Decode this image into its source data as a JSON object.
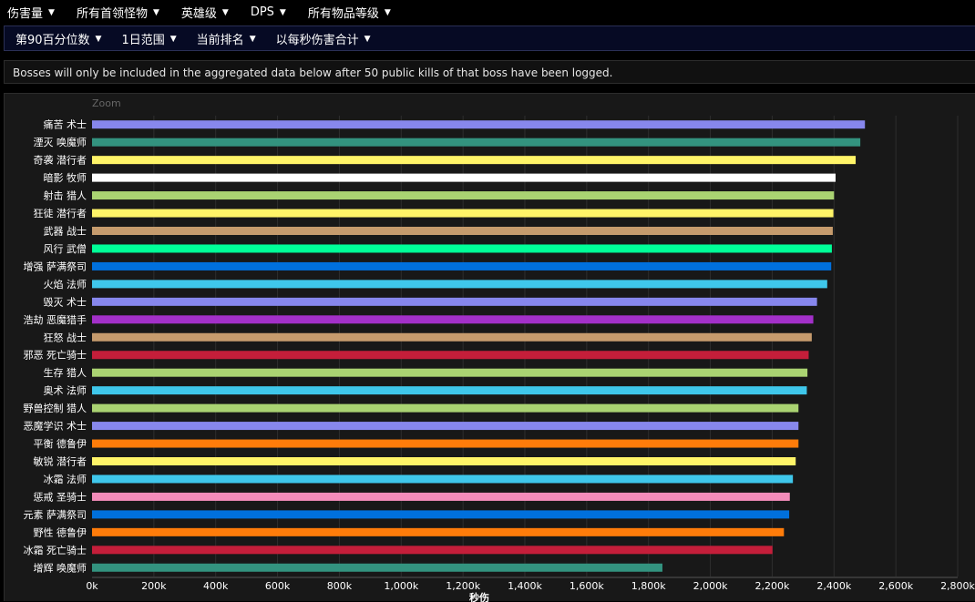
{
  "top_filters": [
    {
      "label": "伤害量",
      "icon": "caret-down-icon"
    },
    {
      "label": "所有首领怪物",
      "icon": "caret-down-icon"
    },
    {
      "label": "英雄级",
      "icon": "caret-down-icon"
    },
    {
      "label": "DPS",
      "icon": "caret-down-icon"
    },
    {
      "label": "所有物品等级",
      "icon": "caret-down-icon"
    }
  ],
  "sub_filters": [
    {
      "label": "第90百分位数",
      "icon": "caret-down-icon"
    },
    {
      "label": "1日范围",
      "icon": "caret-down-icon"
    },
    {
      "label": "当前排名",
      "icon": "caret-down-icon"
    },
    {
      "label": "以每秒伤害合计",
      "icon": "caret-down-icon"
    }
  ],
  "notice": "Bosses will only be included in the aggregated data below after 50 public kills of that boss have been logged.",
  "zoom_label": "Zoom",
  "chart_data": {
    "type": "bar",
    "orientation": "horizontal",
    "title": "",
    "xlabel": "秒伤",
    "ylabel": "",
    "xlim": [
      0,
      2800000
    ],
    "xticks": [
      0,
      200000,
      400000,
      600000,
      800000,
      1000000,
      1200000,
      1400000,
      1600000,
      1800000,
      2000000,
      2200000,
      2400000,
      2600000,
      2800000
    ],
    "xtick_labels": [
      "0k",
      "200k",
      "400k",
      "600k",
      "800k",
      "1,000k",
      "1,200k",
      "1,400k",
      "1,600k",
      "1,800k",
      "2,000k",
      "2,200k",
      "2,400k",
      "2,600k",
      "2,800k"
    ],
    "grid": true,
    "legend": "none",
    "categories": [
      "痛苦 术士",
      "湮灭 唤魔师",
      "奇袭 潜行者",
      "暗影 牧师",
      "射击 猎人",
      "狂徒 潜行者",
      "武器 战士",
      "风行 武僧",
      "增强 萨满祭司",
      "火焰 法师",
      "毁灭 术士",
      "浩劫 恶魔猎手",
      "狂怒 战士",
      "邪恶 死亡骑士",
      "生存 猎人",
      "奥术 法师",
      "野兽控制 猎人",
      "恶魔学识 术士",
      "平衡 德鲁伊",
      "敏锐 潜行者",
      "冰霜 法师",
      "惩戒 圣骑士",
      "元素 萨满祭司",
      "野性 德鲁伊",
      "冰霜 死亡骑士",
      "增辉 唤魔师"
    ],
    "values": [
      2500000,
      2485000,
      2470000,
      2405000,
      2400000,
      2398000,
      2396000,
      2393000,
      2391000,
      2378000,
      2345000,
      2333000,
      2328000,
      2318000,
      2314000,
      2312000,
      2285000,
      2285000,
      2285000,
      2276000,
      2267000,
      2257000,
      2255000,
      2238000,
      2201000,
      1845000
    ],
    "colors": [
      "#8787ed",
      "#33937f",
      "#fff468",
      "#ffffff",
      "#aad372",
      "#fff468",
      "#c69b6d",
      "#00ff98",
      "#0070dd",
      "#3fc7eb",
      "#8787ed",
      "#a330c9",
      "#c69b6d",
      "#c41e3a",
      "#aad372",
      "#3fc7eb",
      "#aad372",
      "#8787ed",
      "#ff7c0a",
      "#fff468",
      "#3fc7eb",
      "#f48cba",
      "#0070dd",
      "#ff7c0a",
      "#c41e3a",
      "#33937f"
    ]
  }
}
